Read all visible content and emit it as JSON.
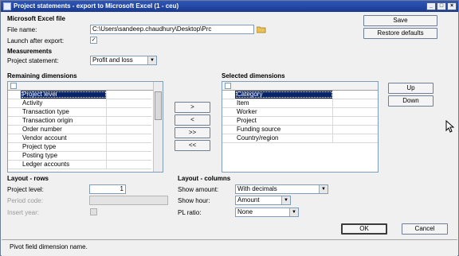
{
  "window": {
    "title": "Project statements - export to Microsoft Excel (1 - ceu)",
    "buttons": [
      "_",
      "□",
      "×"
    ]
  },
  "excel_section": {
    "heading": "Microsoft Excel file",
    "file_name_label": "File name:",
    "file_name_value": "C:\\Users\\sandeep.chaudhury\\Desktop\\Prc",
    "launch_label": "Launch after export:",
    "launch_checked": "✓"
  },
  "measurements": {
    "heading": "Measurements",
    "project_statement_label": "Project statement:",
    "project_statement_value": "Profit and loss"
  },
  "actions": {
    "save": "Save",
    "restore": "Restore defaults",
    "up": "Up",
    "down": "Down",
    "ok": "OK",
    "cancel": "Cancel"
  },
  "remaining": {
    "heading": "Remaining dimensions",
    "items": [
      "Project level",
      "Activity",
      "Transaction type",
      "Transaction origin",
      "Order number",
      "Vendor account",
      "Project type",
      "Posting type",
      "Ledger accounts"
    ]
  },
  "move_buttons": [
    ">",
    "<",
    ">>",
    "<<"
  ],
  "selected": {
    "heading": "Selected dimensions",
    "items": [
      "Category",
      "Item",
      "Worker",
      "Project",
      "Funding source",
      "Country/region"
    ]
  },
  "layout_rows": {
    "heading": "Layout - rows",
    "project_level_label": "Project level:",
    "project_level_value": "1",
    "period_code_label": "Period code:",
    "insert_year_label": "Insert year:"
  },
  "layout_columns": {
    "heading": "Layout - columns",
    "show_amount_label": "Show amount:",
    "show_amount_value": "With decimals",
    "show_hour_label": "Show hour:",
    "show_hour_value": "Amount",
    "pl_ratio_label": "PL ratio:",
    "pl_ratio_value": "None"
  },
  "status": {
    "text": "Pivot field dimension name."
  }
}
